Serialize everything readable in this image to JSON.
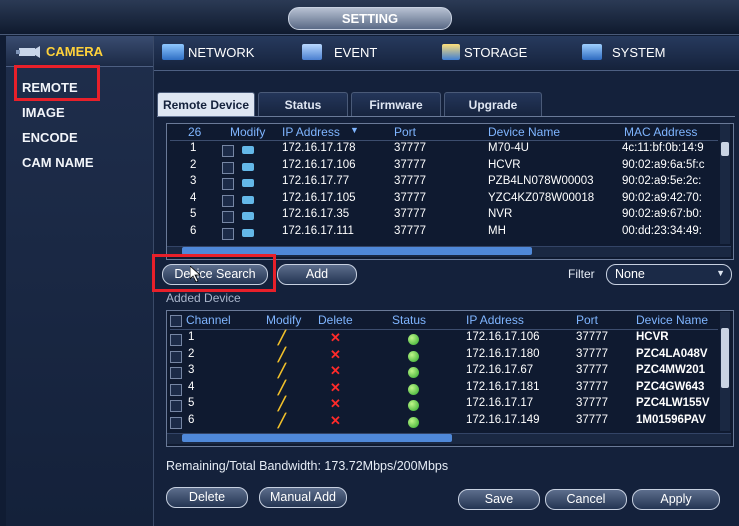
{
  "window": {
    "title": "SETTING"
  },
  "sidebar": {
    "section": "CAMERA",
    "items": [
      "REMOTE",
      "IMAGE",
      "ENCODE",
      "CAM NAME"
    ]
  },
  "topnav": [
    "NETWORK",
    "EVENT",
    "STORAGE",
    "SYSTEM"
  ],
  "tabs": [
    "Remote Device",
    "Status",
    "Firmware",
    "Upgrade"
  ],
  "search_table": {
    "headers": [
      "26",
      "Modify",
      "IP Address",
      "Port",
      "Device Name",
      "MAC Address"
    ],
    "rows": [
      [
        "1",
        "172.16.17.178",
        "37777",
        "M70-4U",
        "4c:11:bf:0b:14:9"
      ],
      [
        "2",
        "172.16.17.106",
        "37777",
        "HCVR",
        "90:02:a9:6a:5f:c"
      ],
      [
        "3",
        "172.16.17.77",
        "37777",
        "PZB4LN078W00003",
        "90:02:a9:5e:2c:"
      ],
      [
        "4",
        "172.16.17.105",
        "37777",
        "YZC4KZ078W00018",
        "90:02:a9:42:70:"
      ],
      [
        "5",
        "172.16.17.35",
        "37777",
        "NVR",
        "90:02:a9:67:b0:"
      ],
      [
        "6",
        "172.16.17.111",
        "37777",
        "MH",
        "00:dd:23:34:49:"
      ]
    ]
  },
  "actions": {
    "device_search": "Device Search",
    "add": "Add",
    "filter_label": "Filter",
    "filter_value": "None"
  },
  "added": {
    "title": "Added Device",
    "headers": [
      "Channel",
      "Modify",
      "Delete",
      "Status",
      "IP Address",
      "Port",
      "Device Name"
    ],
    "rows": [
      [
        "1",
        "172.16.17.106",
        "37777",
        "HCVR"
      ],
      [
        "2",
        "172.16.17.180",
        "37777",
        "PZC4LA048V"
      ],
      [
        "3",
        "172.16.17.67",
        "37777",
        "PZC4MW201"
      ],
      [
        "4",
        "172.16.17.181",
        "37777",
        "PZC4GW643"
      ],
      [
        "5",
        "172.16.17.17",
        "37777",
        "PZC4LW155V"
      ],
      [
        "6",
        "172.16.17.149",
        "37777",
        "1M01596PAV"
      ]
    ]
  },
  "bandwidth": "Remaining/Total Bandwidth: 173.72Mbps/200Mbps",
  "buttons": {
    "delete": "Delete",
    "manual_add": "Manual Add",
    "save": "Save",
    "cancel": "Cancel",
    "apply": "Apply"
  },
  "colors": {
    "highlight": "#e8202a",
    "accent_text": "#ffd23a",
    "header_text": "#7fb5ff"
  }
}
